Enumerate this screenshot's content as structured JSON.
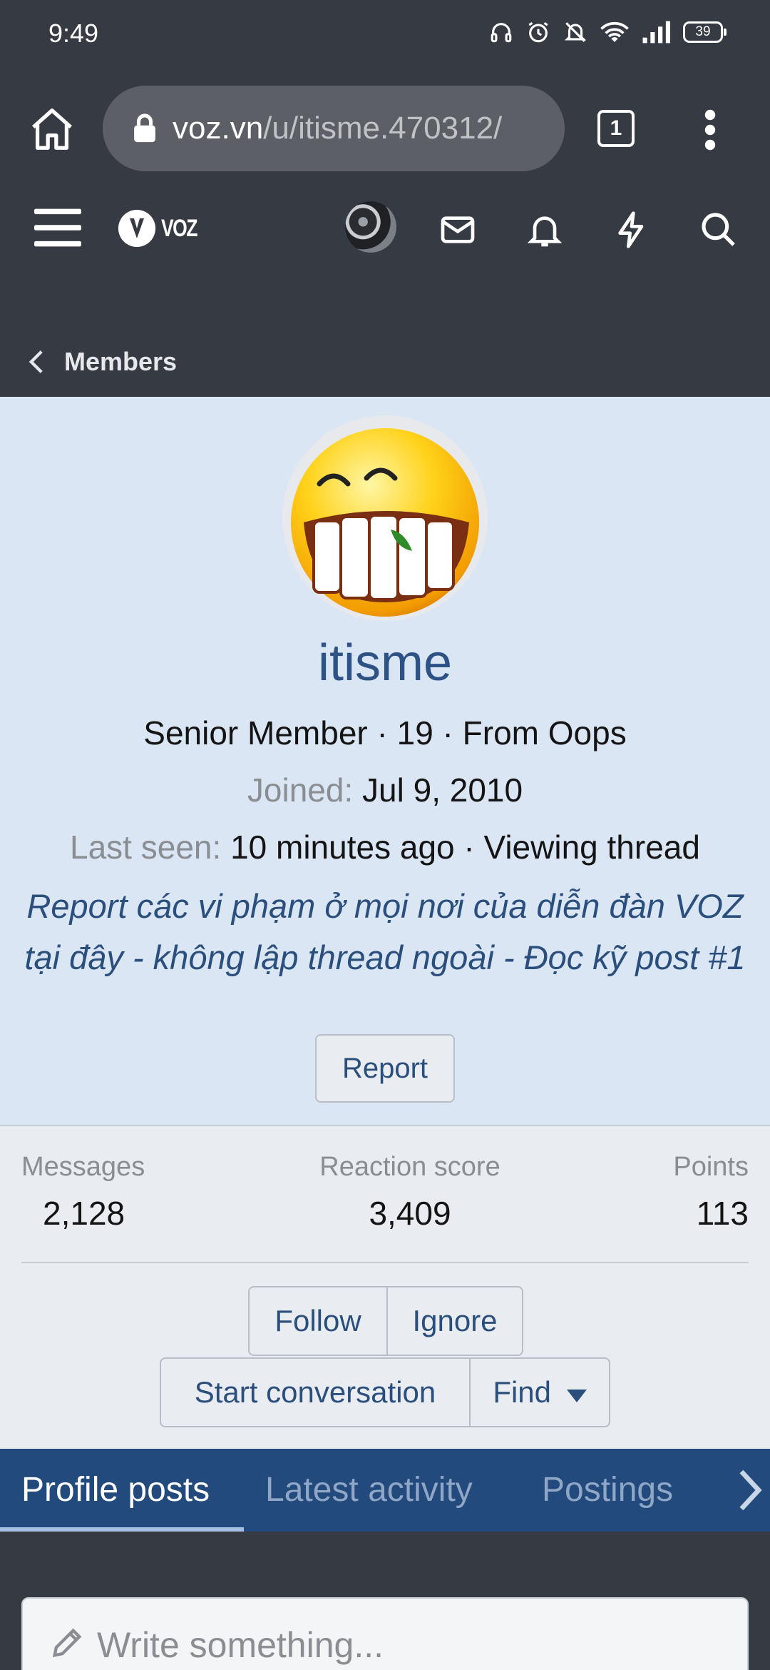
{
  "status_bar": {
    "time": "9:49",
    "battery": "39"
  },
  "browser": {
    "url_domain": "voz.vn",
    "url_path": "/u/itisme.470312/",
    "tab_count": "1"
  },
  "site": {
    "logo_text": "VOZ",
    "breadcrumb": "Members"
  },
  "profile": {
    "username": "itisme",
    "title_line": "Senior Member · 19 · From Oops",
    "joined_label": "Joined:",
    "joined_value": "Jul 9, 2010",
    "last_seen_label": "Last seen:",
    "last_seen_value": "10 minutes ago · Viewing thread",
    "signature": "Report các vi phạm ở mọi nơi của diễn đàn VOZ tại đây - không lập thread ngoài - Đọc kỹ post #1",
    "report_label": "Report"
  },
  "stats": {
    "messages_label": "Messages",
    "messages_value": "2,128",
    "reaction_label": "Reaction score",
    "reaction_value": "3,409",
    "points_label": "Points",
    "points_value": "113"
  },
  "actions": {
    "follow": "Follow",
    "ignore": "Ignore",
    "start_conversation": "Start conversation",
    "find": "Find"
  },
  "tabs": [
    {
      "label": "Profile posts",
      "active": true
    },
    {
      "label": "Latest activity",
      "active": false
    },
    {
      "label": "Postings",
      "active": false
    }
  ],
  "composer": {
    "placeholder": "Write something..."
  },
  "colors": {
    "header_bg": "#363a42",
    "profile_bg": "#dbe6f4",
    "link_blue": "#2b4f7c",
    "tab_bar": "#234a7c"
  }
}
